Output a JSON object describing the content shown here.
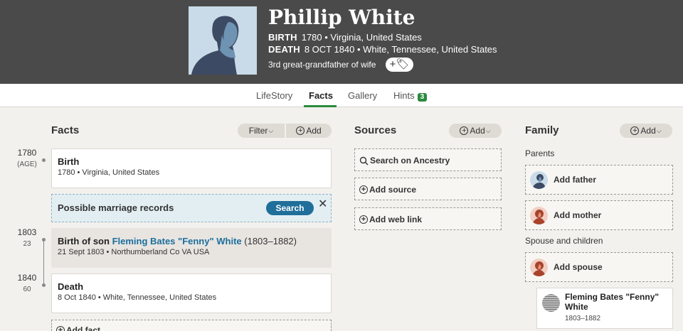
{
  "person": {
    "name": "Phillip White",
    "birth_label": "BIRTH",
    "birth_value": "1780 • Virginia, United States",
    "death_label": "DEATH",
    "death_value": "8 OCT 1840 • White, Tennessee, United States",
    "relationship": "3rd great-grandfather of wife",
    "tag_button": "+🏷"
  },
  "tabs": [
    {
      "label": "LifeStory"
    },
    {
      "label": "Facts"
    },
    {
      "label": "Gallery"
    },
    {
      "label": "Hints",
      "badge": "3"
    }
  ],
  "facts": {
    "title": "Facts",
    "filter_label": "Filter",
    "add_label": "Add",
    "items": [
      {
        "year": "1780",
        "age": "(AGE)",
        "title": "Birth",
        "sub": "1780 • Virginia, United States"
      },
      {
        "year": "1803",
        "age": "23",
        "title_prefix": "Birth of son",
        "link": "Fleming Bates \"Fenny\" White",
        "title_suffix": "(1803–1882)",
        "sub": "21 Sept 1803 • Northumberland Co VA USA"
      },
      {
        "year": "1840",
        "age": "60",
        "title": "Death",
        "sub": "8 Oct 1840 • White, Tennessee, United States"
      }
    ],
    "hint_text": "Possible marriage records",
    "hint_button": "Search",
    "hint_close": "✕",
    "add_fact": "Add fact"
  },
  "sources": {
    "title": "Sources",
    "add_label": "Add",
    "items": [
      {
        "label": "Search on Ancestry"
      },
      {
        "label": "Add source"
      },
      {
        "label": "Add web link"
      }
    ]
  },
  "family": {
    "title": "Family",
    "add_label": "Add",
    "parents_label": "Parents",
    "add_father": "Add father",
    "add_mother": "Add mother",
    "spouse_label": "Spouse and children",
    "add_spouse": "Add spouse",
    "child_name": "Fleming Bates \"Fenny\" White",
    "child_dates": "1803–1882"
  },
  "colors": {
    "header_bg": "#4a4a4a",
    "active_tab": "#2b8a3e",
    "link": "#1c6e9e",
    "search_button": "#1f6f9a"
  },
  "icons": [
    "person-silhouette-icon",
    "tag-icon",
    "plus-circle-icon",
    "chevron-down-icon",
    "search-icon",
    "close-icon",
    "avatar-male-icon",
    "avatar-female-icon"
  ]
}
